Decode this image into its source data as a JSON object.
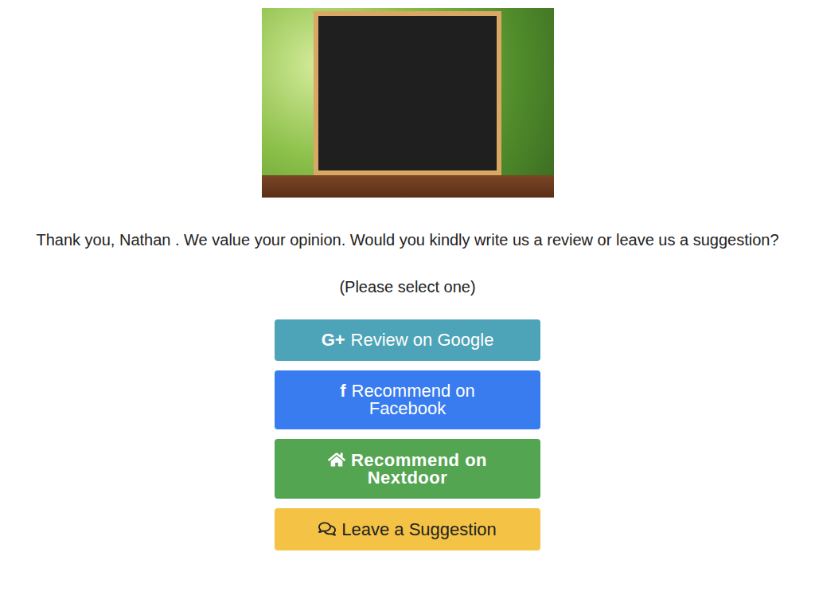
{
  "greeting": "Thank you, Nathan . We value your opinion. Would you kindly write us a review or leave us a suggestion?",
  "instruction": "(Please select one)",
  "buttons": [
    {
      "kind": "google",
      "icon": "G+",
      "label": "Review on Google",
      "color": "#4da3b7"
    },
    {
      "kind": "facebook",
      "icon": "f",
      "label": "Recommend on Facebook",
      "color": "#387cf0"
    },
    {
      "kind": "nextdoor",
      "label": "Recommend on Nextdoor",
      "color": "#53a552"
    },
    {
      "kind": "suggestion",
      "label": "Leave a Suggestion",
      "color": "#f4c245"
    }
  ]
}
